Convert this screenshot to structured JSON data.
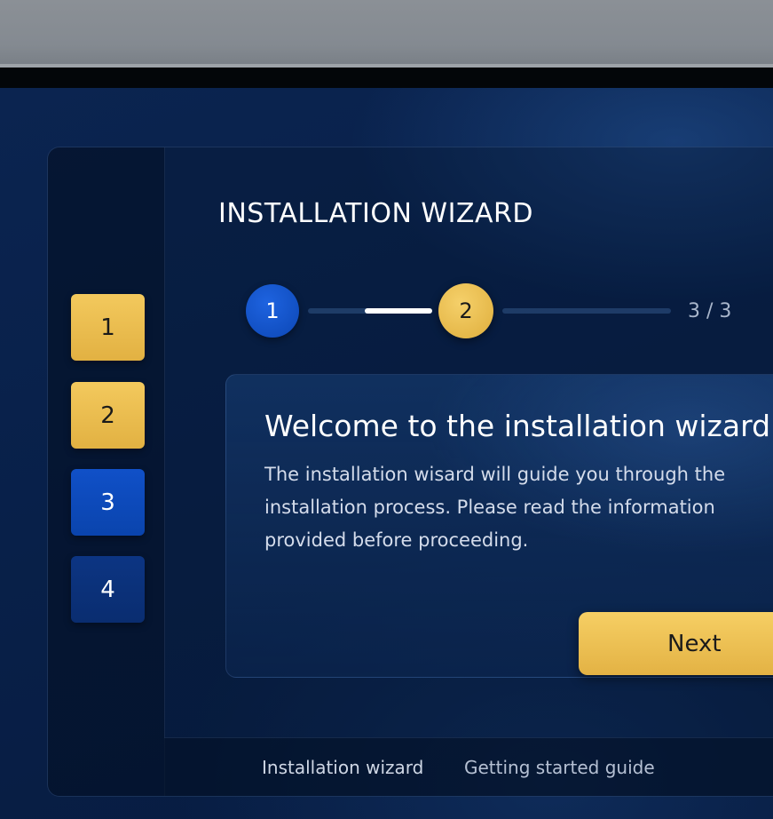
{
  "wizard": {
    "title": "INSTALLATION WIZARD"
  },
  "sidebar": {
    "steps": [
      {
        "label": "1",
        "state": "completed",
        "color": "#ECC04F"
      },
      {
        "label": "2",
        "state": "completed",
        "color": "#ECC04F"
      },
      {
        "label": "3",
        "state": "current",
        "color": "#0C4BBE"
      },
      {
        "label": "4",
        "state": "upcoming",
        "color": "#0B3179"
      }
    ]
  },
  "stepper": {
    "dots": [
      {
        "label": "1",
        "color": "#1558D6"
      },
      {
        "label": "2",
        "color": "#ECC04F"
      }
    ],
    "counter": "3 / 3"
  },
  "card": {
    "heading": "Welcome to the installation wizard",
    "body": "The installation wisard will guide you through the installation process. Please read the information provided before proceeding."
  },
  "actions": {
    "next_label": "Next"
  },
  "footer": {
    "links": [
      "Installation wizard",
      "Getting started guide"
    ]
  },
  "colors": {
    "accent_gold": "#ECC04F",
    "accent_blue": "#1558D6",
    "background": "#082049"
  }
}
